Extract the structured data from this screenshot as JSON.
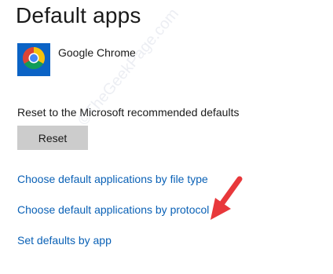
{
  "page": {
    "title": "Default apps"
  },
  "web_browser": {
    "app_name": "Google Chrome",
    "icon": "chrome-icon"
  },
  "reset": {
    "label": "Reset to the Microsoft recommended defaults",
    "button_label": "Reset"
  },
  "links": {
    "by_file_type": "Choose default applications by file type",
    "by_protocol": "Choose default applications by protocol",
    "by_app": "Set defaults by app"
  },
  "overlay": {
    "watermark": "©TheGeekPage.com",
    "annotation_arrow_color": "#e8383b"
  },
  "colors": {
    "accent_tile": "#0b63c5",
    "link": "#0a61b6",
    "button_bg": "#cccccc"
  }
}
